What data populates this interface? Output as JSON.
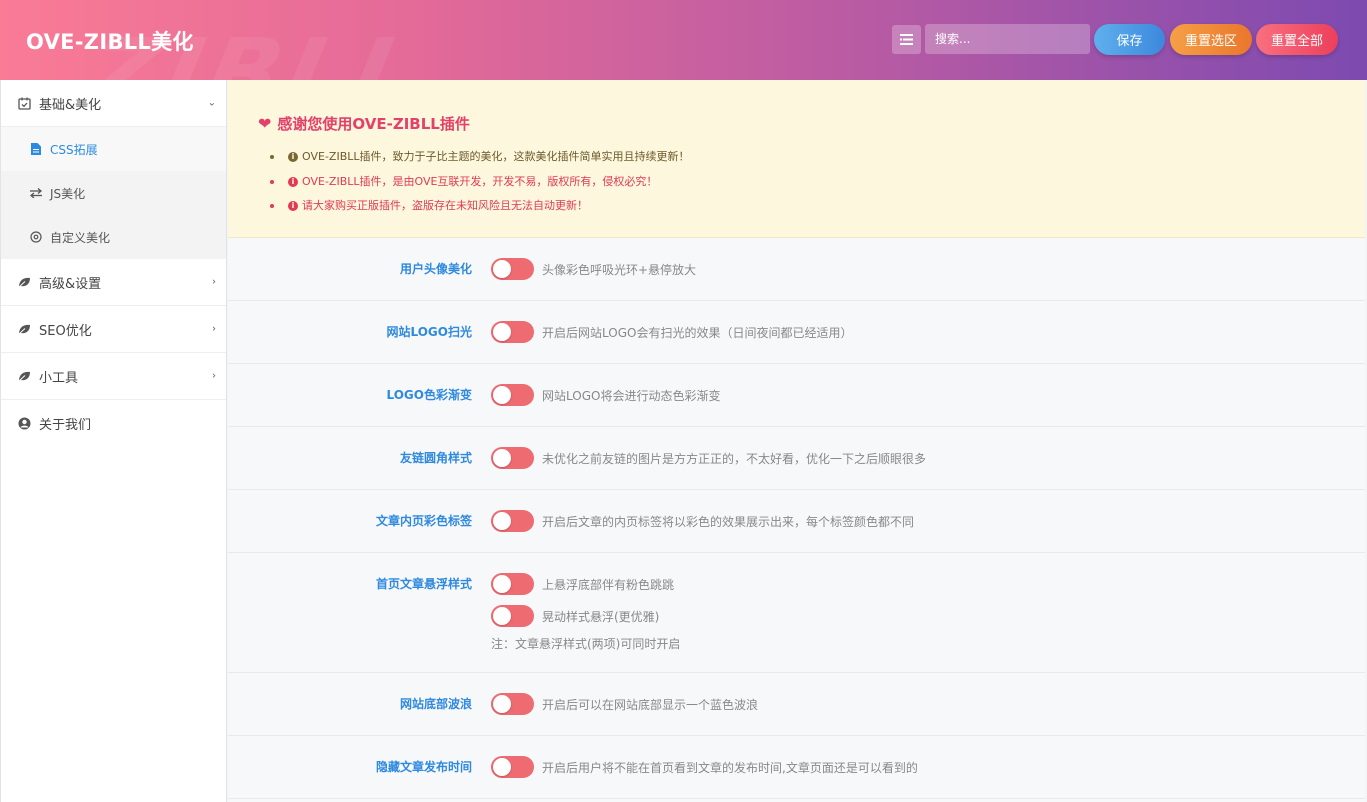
{
  "header": {
    "title": "OVE-ZIBLL美化",
    "watermark": "ZIBLL",
    "search_placeholder": "搜索...",
    "save_label": "保存",
    "reset_section_label": "重置选区",
    "reset_all_label": "重置全部"
  },
  "sidebar": {
    "items": [
      {
        "label": "基础&美化",
        "icon": "calendar-check-icon",
        "expanded": true,
        "children": [
          {
            "label": "CSS拓展",
            "icon": "file-icon",
            "active": true
          },
          {
            "label": "JS美化",
            "icon": "exchange-icon"
          },
          {
            "label": "自定义美化",
            "icon": "settings-icon"
          }
        ]
      },
      {
        "label": "高级&设置",
        "icon": "leaf-icon"
      },
      {
        "label": "SEO优化",
        "icon": "leaf-icon"
      },
      {
        "label": "小工具",
        "icon": "leaf-icon"
      },
      {
        "label": "关于我们",
        "icon": "user-circle-icon"
      }
    ]
  },
  "notice": {
    "title": "感谢您使用OVE-ZIBLL插件",
    "items": [
      "OVE-ZIBLL插件，致力于子比主题的美化，这款美化插件简单实用且持续更新！",
      "OVE-ZIBLL插件，是由OVE互联开发，开发不易，版权所有，侵权必究！",
      "请大家购买正版插件，盗版存在未知风险且无法自动更新！"
    ]
  },
  "settings": [
    {
      "label": "用户头像美化",
      "options": [
        "头像彩色呼吸光环+悬停放大"
      ]
    },
    {
      "label": "网站LOGO扫光",
      "options": [
        "开启后网站LOGO会有扫光的效果（日间夜间都已经适用）"
      ]
    },
    {
      "label": "LOGO色彩渐变",
      "options": [
        "网站LOGO将会进行动态色彩渐变"
      ]
    },
    {
      "label": "友链圆角样式",
      "options": [
        "未优化之前友链的图片是方方正正的，不太好看，优化一下之后顺眼很多"
      ]
    },
    {
      "label": "文章内页彩色标签",
      "options": [
        "开启后文章的内页标签将以彩色的效果展示出来，每个标签颜色都不同"
      ]
    },
    {
      "label": "首页文章悬浮样式",
      "options": [
        "上悬浮底部伴有粉色跳跳",
        "晃动样式悬浮(更优雅)"
      ],
      "note": "注：文章悬浮样式(两项)可同时开启"
    },
    {
      "label": "网站底部波浪",
      "options": [
        "开启后可以在网站底部显示一个蓝色波浪"
      ]
    },
    {
      "label": "隐藏文章发布时间",
      "options": [
        "开启后用户将不能在首页看到文章的发布时间,文章页面还是可以看到的"
      ]
    }
  ],
  "colors": {
    "accent_blue": "#2f89df",
    "toggle_off": "#ee6b71",
    "notice_bg": "#fdf7dd",
    "notice_red": "#e03a54"
  }
}
